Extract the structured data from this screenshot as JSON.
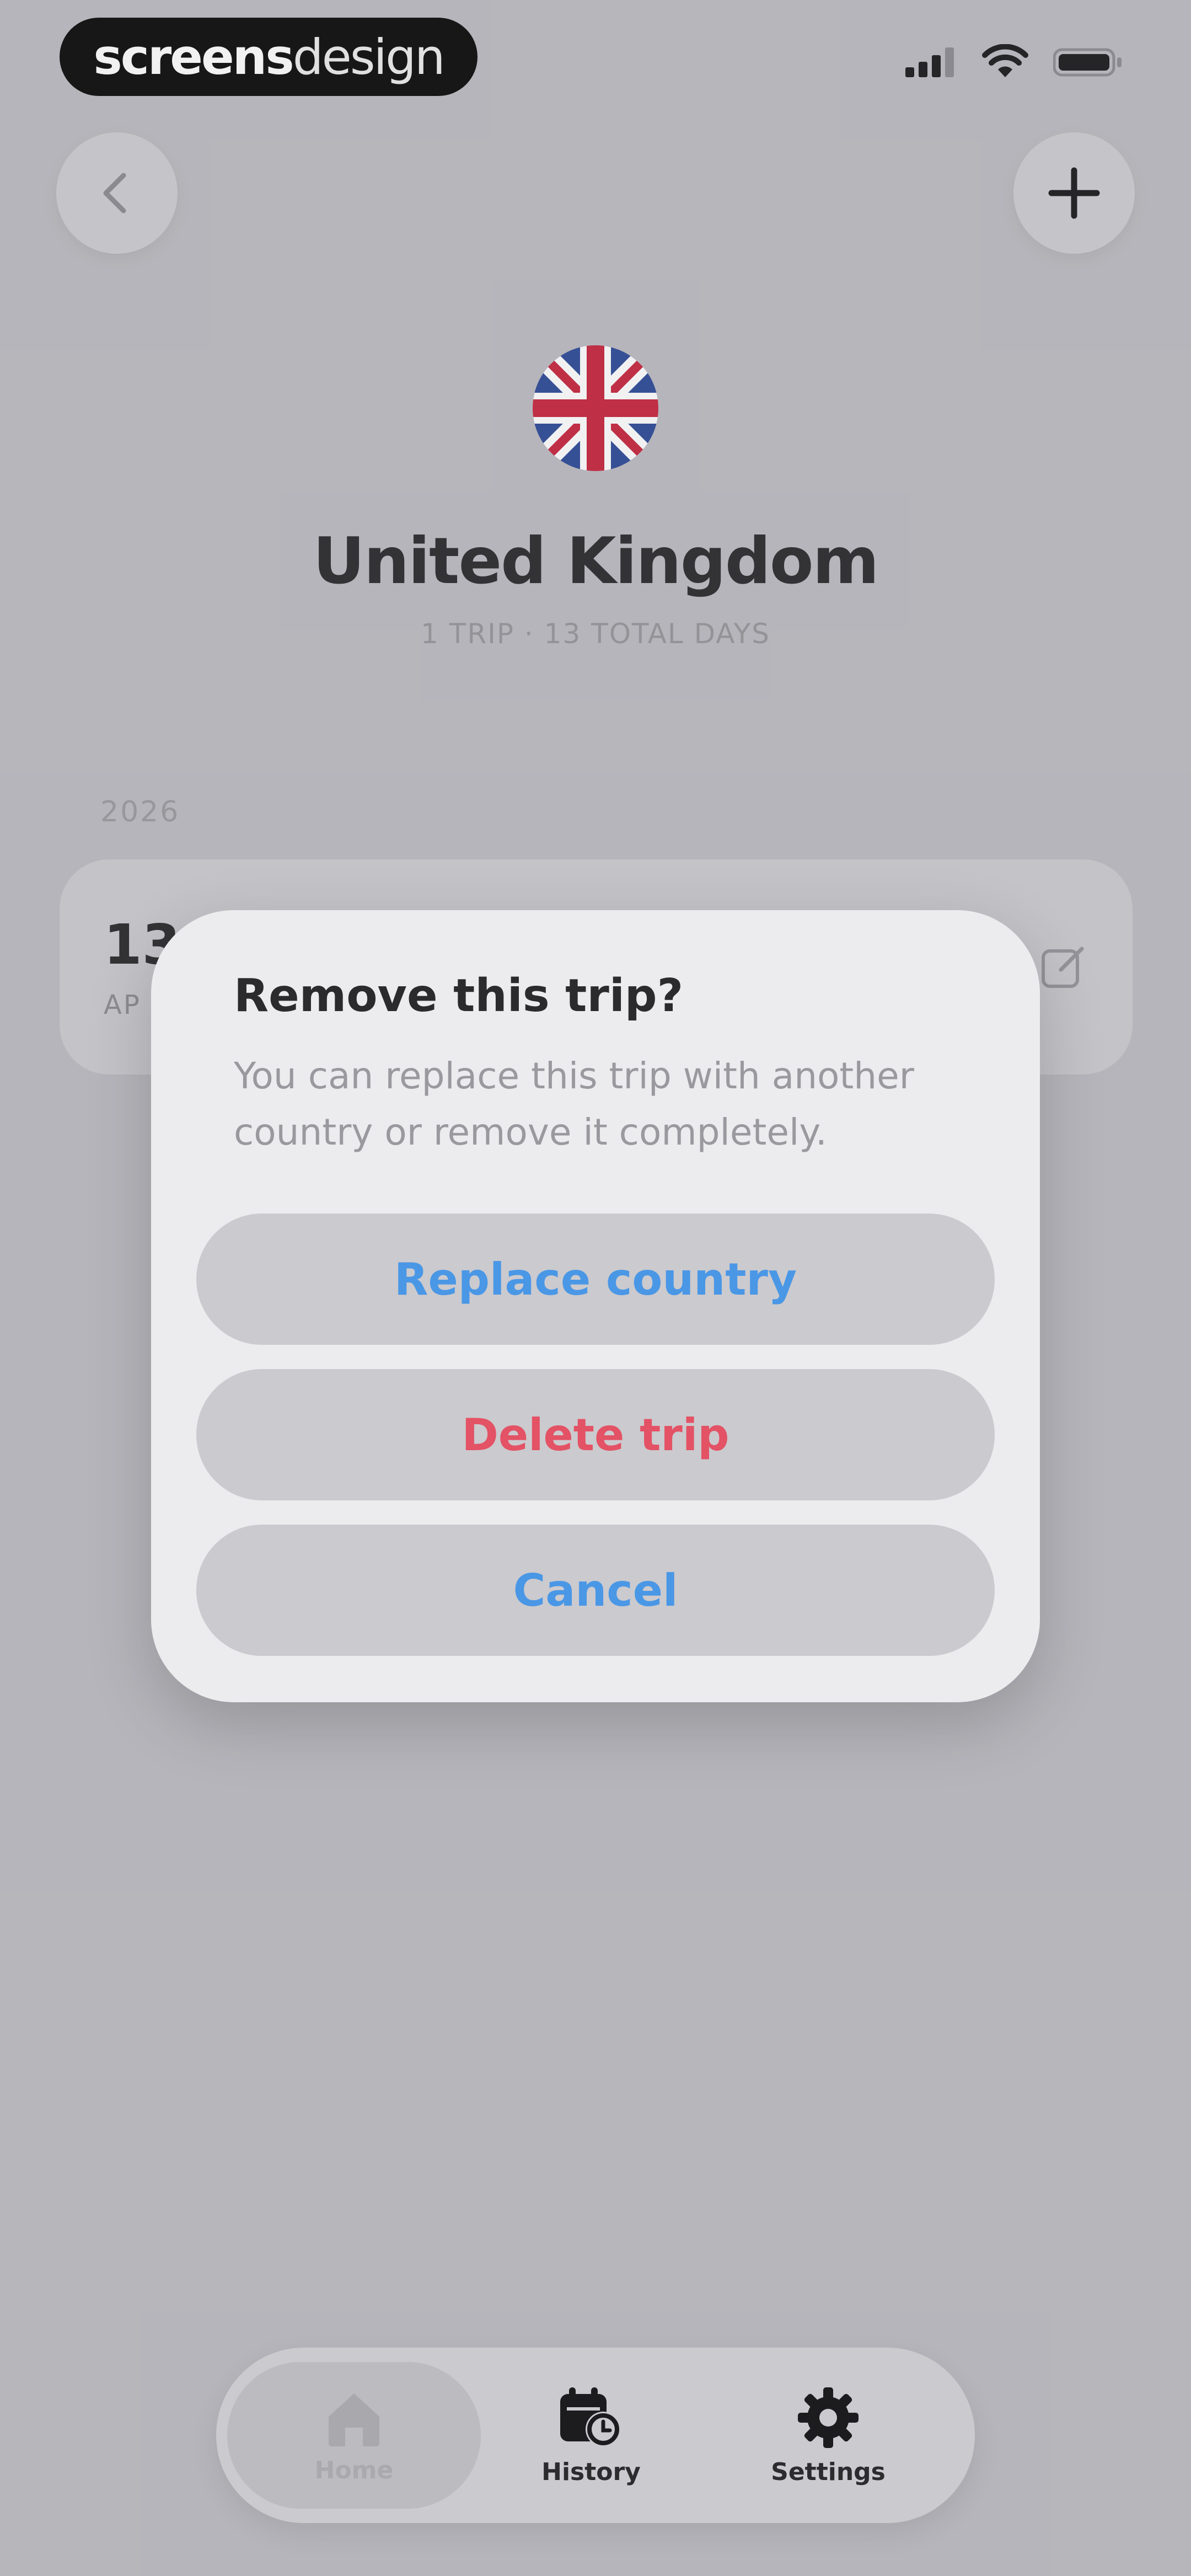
{
  "brand": {
    "part1": "screens",
    "part2": "design"
  },
  "header": {
    "country": "United Kingdom",
    "subtitle": "1 TRIP · 13 TOTAL DAYS"
  },
  "trips": {
    "year": "2026",
    "card": {
      "days": "13",
      "month": "AP"
    }
  },
  "dialog": {
    "title": "Remove this trip?",
    "message": "You can replace this trip with another country or remove it completely.",
    "replace_label": "Replace country",
    "delete_label": "Delete trip",
    "cancel_label": "Cancel"
  },
  "tabs": [
    {
      "label": "Home",
      "icon": "home-icon",
      "selected": true
    },
    {
      "label": "History",
      "icon": "calendar-clock-icon"
    },
    {
      "label": "Settings",
      "icon": "gear-icon"
    }
  ],
  "colors": {
    "replace": "#4a97e6",
    "delete": "#e35265",
    "cancel": "#4a97e6"
  },
  "icons": {
    "back": "chevron-left-icon",
    "add": "plus-icon",
    "flag": "uk-flag-icon",
    "edit": "edit-icon"
  }
}
